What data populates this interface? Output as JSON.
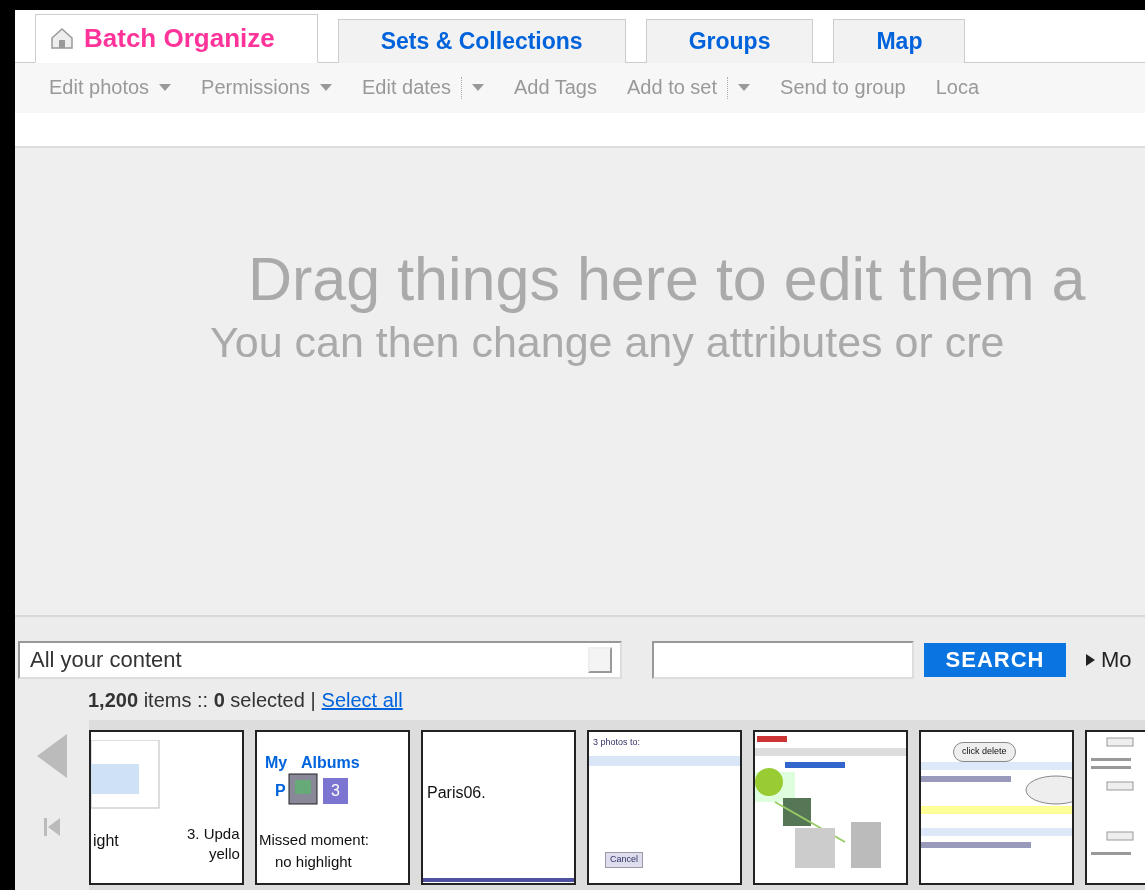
{
  "tabs": [
    {
      "label": "Batch Organize",
      "selected": true
    },
    {
      "label": "Sets & Collections",
      "selected": false
    },
    {
      "label": "Groups",
      "selected": false
    },
    {
      "label": "Map",
      "selected": false
    }
  ],
  "toolbar": [
    {
      "label": "Edit photos",
      "kind": "dropdown"
    },
    {
      "label": "Permissions",
      "kind": "dropdown"
    },
    {
      "label": "Edit dates",
      "kind": "split"
    },
    {
      "label": "Add Tags",
      "kind": "plain"
    },
    {
      "label": "Add to set",
      "kind": "split"
    },
    {
      "label": "Send to group",
      "kind": "plain"
    },
    {
      "label": "Loca",
      "kind": "plain"
    }
  ],
  "drop_area": {
    "heading": "Drag things here to edit them a",
    "subheading": "You can then change any attributes or cre"
  },
  "filter": {
    "value": "All your content"
  },
  "search": {
    "button": "SEARCH",
    "more": "Mo"
  },
  "status": {
    "count": "1,200",
    "count_label": "items ::",
    "selected": "0",
    "selected_label": "selected |",
    "select_all": "Select all"
  },
  "thumbnails": [
    {
      "kind": "slide",
      "lines": [
        "ight",
        "3. Upda",
        "yello"
      ]
    },
    {
      "kind": "albums",
      "lines": [
        "My",
        "Albums",
        "P",
        "3",
        "Missed moment:",
        "no highlight"
      ]
    },
    {
      "kind": "note",
      "lines": [
        "Paris06."
      ]
    },
    {
      "kind": "dialog",
      "lines": [
        "3 photos to:",
        "Cancel"
      ]
    },
    {
      "kind": "app"
    },
    {
      "kind": "callout",
      "lines": [
        "click delete"
      ]
    },
    {
      "kind": "form"
    }
  ]
}
